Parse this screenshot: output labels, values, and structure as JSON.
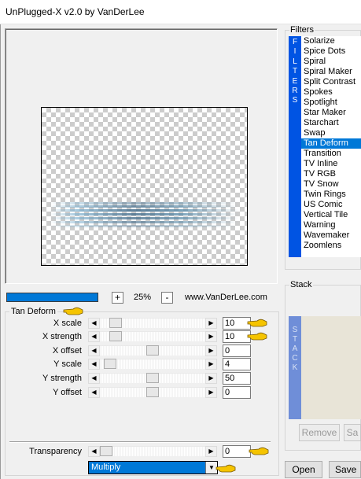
{
  "window": {
    "title": "UnPlugged-X v2.0 by VanDerLee"
  },
  "zoom": {
    "minus_label": "-",
    "plus_label": "+",
    "value": "25%",
    "progress": 1.0,
    "website": "www.VanDerLee.com"
  },
  "filter_panel": {
    "title": "Filters",
    "side_label": "FILTERS",
    "items": [
      "Solarize",
      "Spice Dots",
      "Spiral",
      "Spiral Maker",
      "Split Contrast",
      "Spokes",
      "Spotlight",
      "Star Maker",
      "Starchart",
      "Swap",
      "Tan Deform",
      "Transition",
      "TV Inline",
      "TV RGB",
      "TV Snow",
      "Twin Rings",
      "US Comic",
      "Vertical Tile",
      "Warning",
      "Wavemaker",
      "Zoomlens"
    ],
    "selected": "Tan Deform"
  },
  "stack_panel": {
    "title": "Stack",
    "side_label": "STACK",
    "remove_label": "Remove",
    "save_short_label": "Sa"
  },
  "params": {
    "group_title": "Tan Deform",
    "left_arrow": "◀",
    "right_arrow": "▶",
    "rows": [
      {
        "label": "X scale",
        "value": "10",
        "level": 0.1
      },
      {
        "label": "X strength",
        "value": "10",
        "level": 0.1
      },
      {
        "label": "X offset",
        "value": "0",
        "level": 0.5
      },
      {
        "label": "Y scale",
        "value": "4",
        "level": 0.04
      },
      {
        "label": "Y strength",
        "value": "50",
        "level": 0.5
      },
      {
        "label": "Y offset",
        "value": "0",
        "level": 0.5
      }
    ],
    "transparency": {
      "label": "Transparency",
      "value": "0",
      "level": 0.0
    },
    "blend_mode": "Multiply",
    "dropdown_caret": "▼"
  },
  "footer": {
    "open_label": "Open",
    "save_label": "Save"
  },
  "colors": {
    "selection": "#0078d7",
    "filters_side": "#0054e3",
    "stack_side": "#6f8ed8",
    "hand_pointer": "#f5c400"
  }
}
